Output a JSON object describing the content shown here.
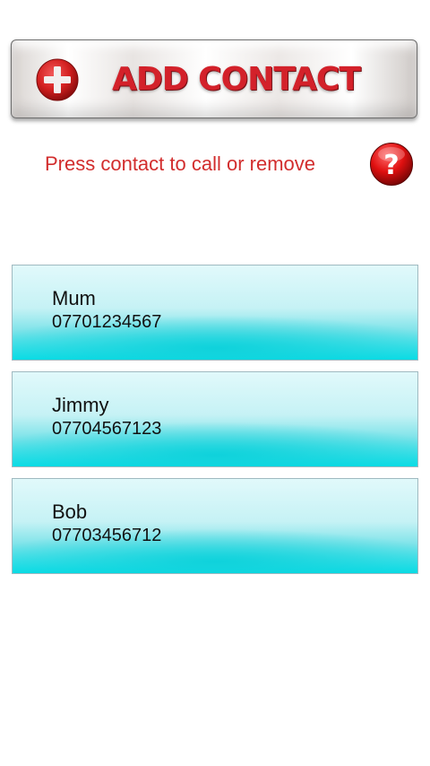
{
  "add_button": {
    "label": "ADD CONTACT",
    "icon": "plus-circle-icon"
  },
  "instruction": "Press contact to call or remove",
  "help": {
    "icon": "help-question-icon"
  },
  "colors": {
    "accent_red": "#d3212a",
    "instruction_red": "#d22d2d",
    "contact_cyan": "#08dde6"
  },
  "contacts": [
    {
      "name": "Mum",
      "phone": "07701234567"
    },
    {
      "name": "Jimmy",
      "phone": "07704567123"
    },
    {
      "name": "Bob",
      "phone": "07703456712"
    }
  ]
}
